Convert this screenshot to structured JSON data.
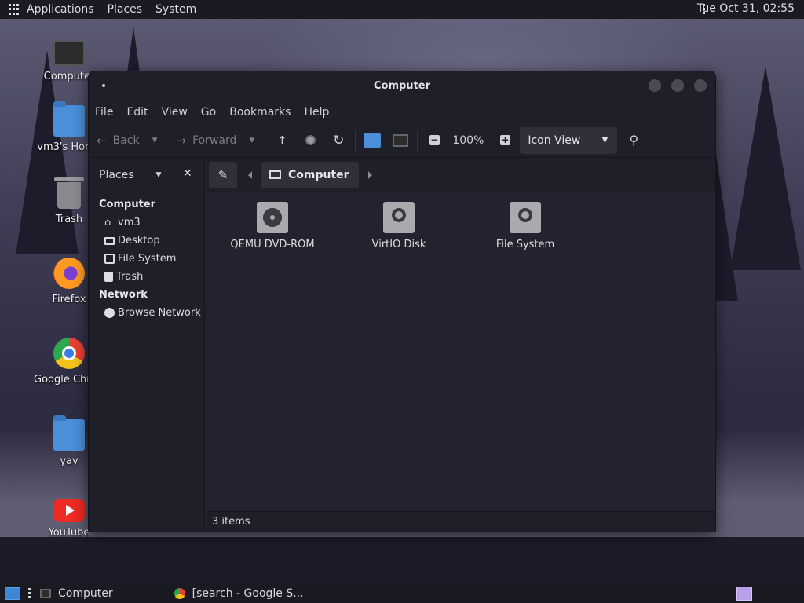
{
  "top_panel": {
    "menus": [
      "Applications",
      "Places",
      "System"
    ],
    "clock": "Tue Oct 31, 02:55"
  },
  "desktop_icons": [
    {
      "label": "Computer",
      "icon": "computer-icon"
    },
    {
      "label": "vm3's Home",
      "icon": "home-folder-icon"
    },
    {
      "label": "Trash",
      "icon": "trash-icon"
    },
    {
      "label": "Firefox",
      "icon": "firefox-icon"
    },
    {
      "label": "Google Chrome",
      "icon": "chrome-icon"
    },
    {
      "label": "yay",
      "icon": "folder-icon"
    },
    {
      "label": "YouTube",
      "icon": "youtube-icon"
    }
  ],
  "window": {
    "title": "Computer",
    "menu": [
      "File",
      "Edit",
      "View",
      "Go",
      "Bookmarks",
      "Help"
    ],
    "toolbar": {
      "back": "Back",
      "forward": "Forward",
      "zoom": "100%",
      "view_mode": "Icon View"
    },
    "sidebar": {
      "header": "Places",
      "groups": [
        {
          "title": "Computer",
          "items": [
            {
              "label": "vm3",
              "icon": "home-icon"
            },
            {
              "label": "Desktop",
              "icon": "desktop-icon"
            },
            {
              "label": "File System",
              "icon": "drive-icon"
            },
            {
              "label": "Trash",
              "icon": "trash-icon"
            }
          ]
        },
        {
          "title": "Network",
          "items": [
            {
              "label": "Browse Network",
              "icon": "network-icon"
            }
          ]
        }
      ]
    },
    "pathbar": {
      "current": "Computer"
    },
    "files": [
      {
        "label": "QEMU DVD-ROM",
        "icon": "optical-disc-icon"
      },
      {
        "label": "VirtIO Disk",
        "icon": "hard-drive-icon"
      },
      {
        "label": "File System",
        "icon": "hard-drive-icon"
      }
    ],
    "status": "3 items"
  },
  "bottom_panel": {
    "tasks": [
      {
        "label": "Computer",
        "icon": "computer-icon"
      },
      {
        "label": "[search - Google S...",
        "icon": "chrome-icon"
      }
    ]
  },
  "colors": {
    "accent": "#3d86d8",
    "window_bg": "#23232f",
    "panel_bg": "#1a1a22"
  }
}
